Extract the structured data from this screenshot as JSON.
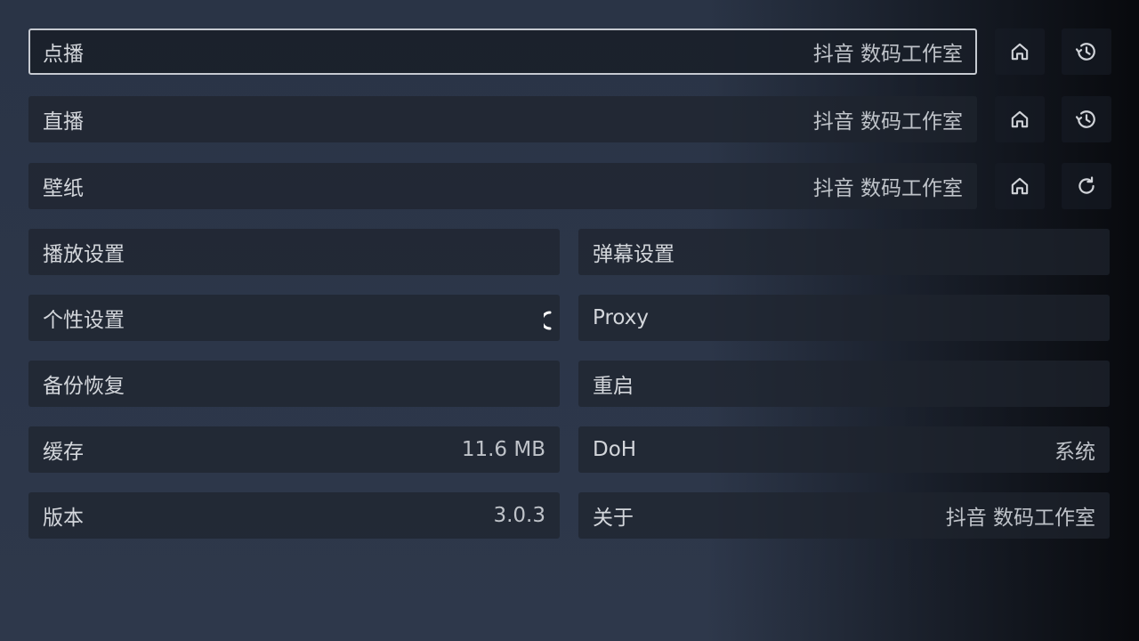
{
  "rows_top": [
    {
      "label": "点播",
      "value": "抖音 数码工作室",
      "second_icon": "history-icon"
    },
    {
      "label": "直播",
      "value": "抖音 数码工作室",
      "second_icon": "history-icon"
    },
    {
      "label": "壁纸",
      "value": "抖音 数码工作室",
      "second_icon": "refresh-icon"
    }
  ],
  "grid": {
    "play_settings": {
      "label": "播放设置",
      "value": ""
    },
    "danmaku_settings": {
      "label": "弹幕设置",
      "value": ""
    },
    "personal_settings": {
      "label": "个性设置",
      "value": ""
    },
    "proxy": {
      "label": "Proxy",
      "value": ""
    },
    "backup_restore": {
      "label": "备份恢复",
      "value": ""
    },
    "restart": {
      "label": "重启",
      "value": ""
    },
    "cache": {
      "label": "缓存",
      "value": "11.6 MB"
    },
    "doh": {
      "label": "DoH",
      "value": "系统"
    },
    "version": {
      "label": "版本",
      "value": "3.0.3"
    },
    "about": {
      "label": "关于",
      "value": "抖音 数码工作室"
    }
  },
  "colors": {
    "background": "#2b3547",
    "item": "#1f2530",
    "focus_border": "#c6cad1",
    "text": "#d3d6db"
  }
}
